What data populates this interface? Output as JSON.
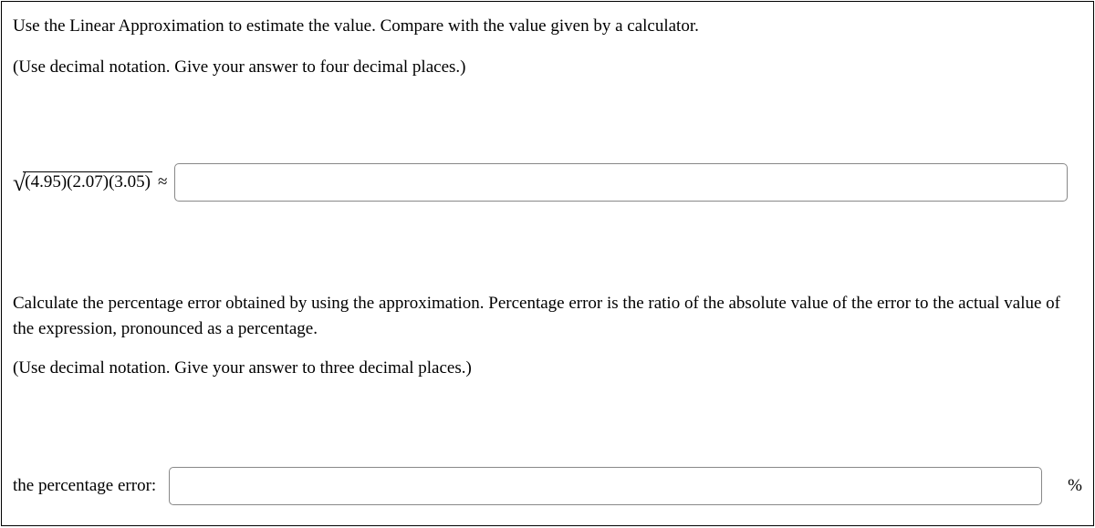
{
  "intro": {
    "line1": "Use the Linear Approximation to estimate the value. Compare with the value given by a calculator.",
    "line2": "(Use decimal notation. Give your answer to four decimal places.)"
  },
  "q1": {
    "radicand": "(4.95)(2.07)(3.05)",
    "approx_symbol": "≈",
    "input_value": ""
  },
  "mid": {
    "line1": "Calculate the percentage error obtained by using the approximation. Percentage error is the ratio of the absolute value of the error to the actual value of the expression, pronounced as a percentage.",
    "line2": "(Use decimal notation. Give your answer to three decimal places.)"
  },
  "q2": {
    "label": "the percentage error:",
    "input_value": "",
    "unit": "%"
  }
}
